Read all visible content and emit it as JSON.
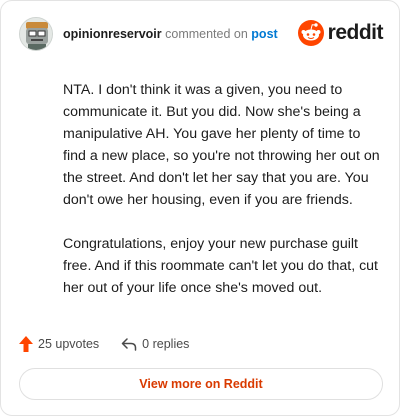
{
  "header": {
    "username": "opinionreservoir",
    "commented_on": "commented on",
    "post_link": "post",
    "logo_text": "reddit",
    "logo_icon": "reddit-alien-icon"
  },
  "comment": {
    "paragraphs": [
      "NTA. I don't think it was a given, you need to communicate it. But you did. Now she's being a manipulative AH. You gave her plenty of time to find a new place, so you're not throwing her out on the street. And don't let her say that you are. You don't owe her housing, even if you are friends.",
      "Congratulations, enjoy your new purchase guilt free. And if this roommate can't let you do that, cut her out of your life once she's moved out."
    ]
  },
  "footer": {
    "upvotes": "25 upvotes",
    "replies": "0 replies",
    "upvote_icon": "upvote-arrow-icon",
    "reply_icon": "reply-arrow-icon",
    "view_more": "View more on Reddit"
  },
  "colors": {
    "brand": "#ff4500",
    "link": "#0079d3",
    "view_more_text": "#d93a00"
  }
}
